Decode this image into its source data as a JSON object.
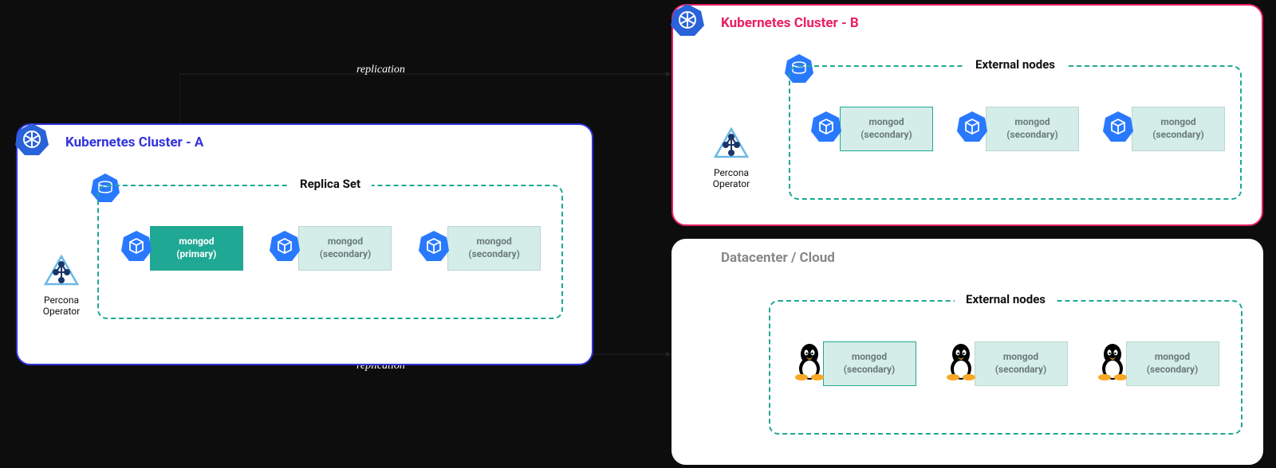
{
  "clusterA": {
    "title": "Kubernetes Cluster - A",
    "group": "Replica Set",
    "operator": "Percona\nOperator",
    "nodes": [
      {
        "l1": "mongod",
        "l2": "(primary)",
        "style": "primary"
      },
      {
        "l1": "mongod",
        "l2": "(secondary)",
        "style": "secondary"
      },
      {
        "l1": "mongod",
        "l2": "(secondary)",
        "style": "secondary"
      }
    ]
  },
  "clusterB": {
    "title": "Kubernetes Cluster - B",
    "group": "External nodes",
    "operator": "Percona\nOperator",
    "nodes": [
      {
        "l1": "mongod",
        "l2": "(secondary)",
        "style": "highlight"
      },
      {
        "l1": "mongod",
        "l2": "(secondary)",
        "style": "secondary"
      },
      {
        "l1": "mongod",
        "l2": "(secondary)",
        "style": "secondary"
      }
    ]
  },
  "dc": {
    "title": "Datacenter / Cloud",
    "group": "External nodes",
    "nodes": [
      {
        "l1": "mongod",
        "l2": "(secondary)",
        "style": "highlight"
      },
      {
        "l1": "mongod",
        "l2": "(secondary)",
        "style": "secondary"
      },
      {
        "l1": "mongod",
        "l2": "(secondary)",
        "style": "secondary"
      }
    ]
  },
  "arrows": {
    "r1": "replication",
    "r2": "replication"
  },
  "colors": {
    "clusterA": "#3333dd",
    "clusterB": "#e91e63",
    "accent": "#1fa894",
    "cube": "#2979ff"
  }
}
